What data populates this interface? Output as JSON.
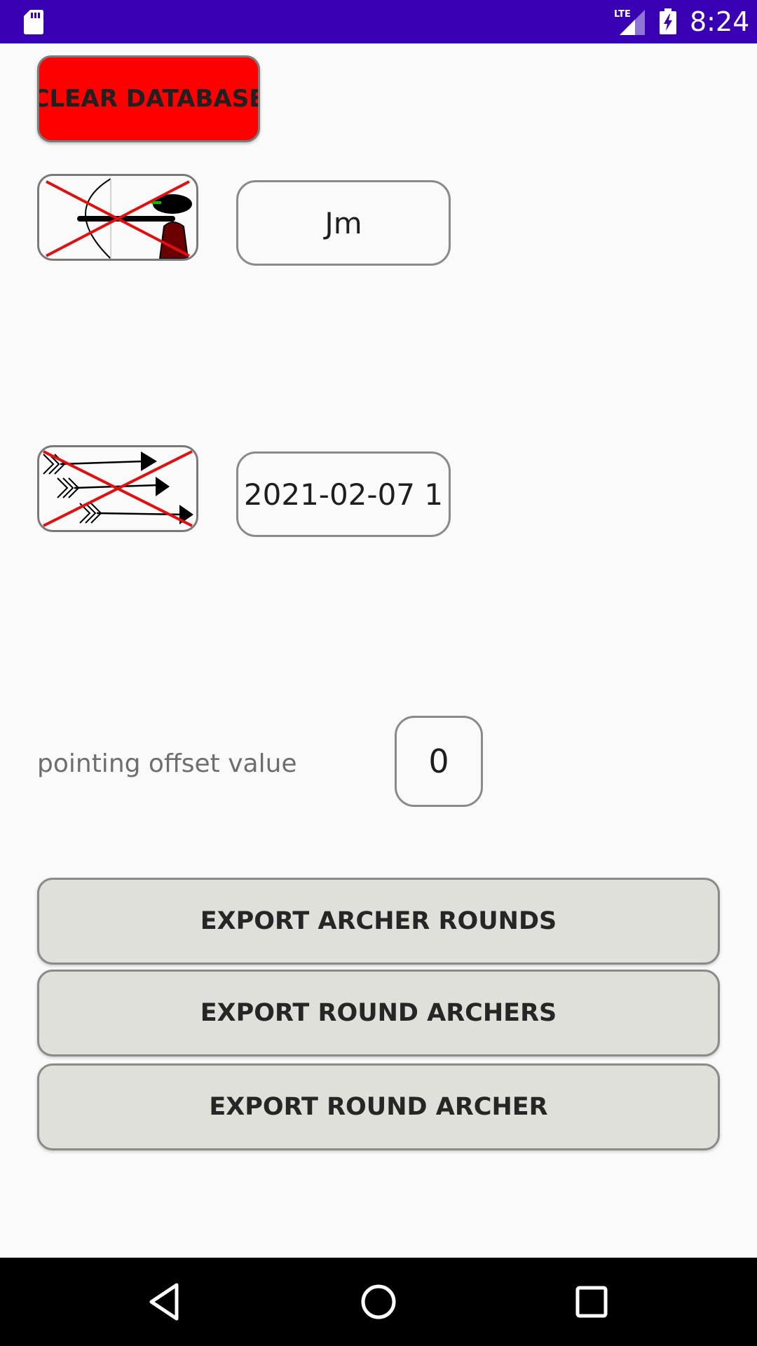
{
  "status_bar": {
    "time": "8:24",
    "network": "LTE",
    "icons": [
      "sd-card-icon",
      "lte-signal-icon",
      "battery-charging-icon"
    ]
  },
  "clear_button": {
    "label": "CLEAR DATABASE",
    "color": "#ff0000"
  },
  "archer": {
    "icon": "archer-cross-icon",
    "value": "Jm"
  },
  "round": {
    "icon": "arrows-cross-icon",
    "value": "2021-02-07 1"
  },
  "offset": {
    "label": "pointing offset value",
    "value": "0"
  },
  "exports": [
    {
      "label": "EXPORT ARCHER ROUNDS"
    },
    {
      "label": "EXPORT ROUND ARCHERS"
    },
    {
      "label": "EXPORT ROUND ARCHER"
    }
  ],
  "nav_bar": {
    "icons": [
      "back-icon",
      "home-icon",
      "recents-icon"
    ]
  },
  "colors": {
    "status_bar": "#3a00b4",
    "background": "#fafafa",
    "export_button": "#e0e0da",
    "cross": "#e01010"
  }
}
